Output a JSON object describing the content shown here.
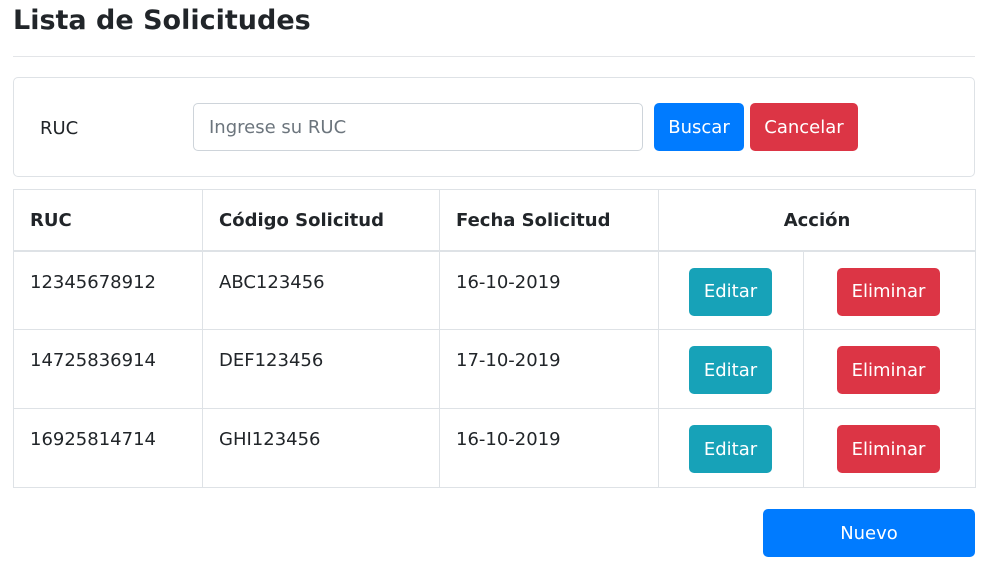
{
  "page": {
    "title": "Lista de Solicitudes"
  },
  "search": {
    "label": "RUC",
    "placeholder": "Ingrese su RUC",
    "value": "",
    "search_button": "Buscar",
    "cancel_button": "Cancelar"
  },
  "table": {
    "headers": {
      "ruc": "RUC",
      "codigo": "Código Solicitud",
      "fecha": "Fecha Solicitud",
      "accion": "Acción"
    },
    "rows": [
      {
        "ruc": "12345678912",
        "codigo": "ABC123456",
        "fecha": "16-10-2019",
        "edit": "Editar",
        "delete": "Eliminar"
      },
      {
        "ruc": "14725836914",
        "codigo": "DEF123456",
        "fecha": "17-10-2019",
        "edit": "Editar",
        "delete": "Eliminar"
      },
      {
        "ruc": "16925814714",
        "codigo": "GHI123456",
        "fecha": "16-10-2019",
        "edit": "Editar",
        "delete": "Eliminar"
      }
    ]
  },
  "footer": {
    "new_button": "Nuevo"
  },
  "colors": {
    "primary": "#007bff",
    "danger": "#dc3545",
    "info": "#17a2b8",
    "border": "#dee2e6",
    "text": "#212529"
  }
}
